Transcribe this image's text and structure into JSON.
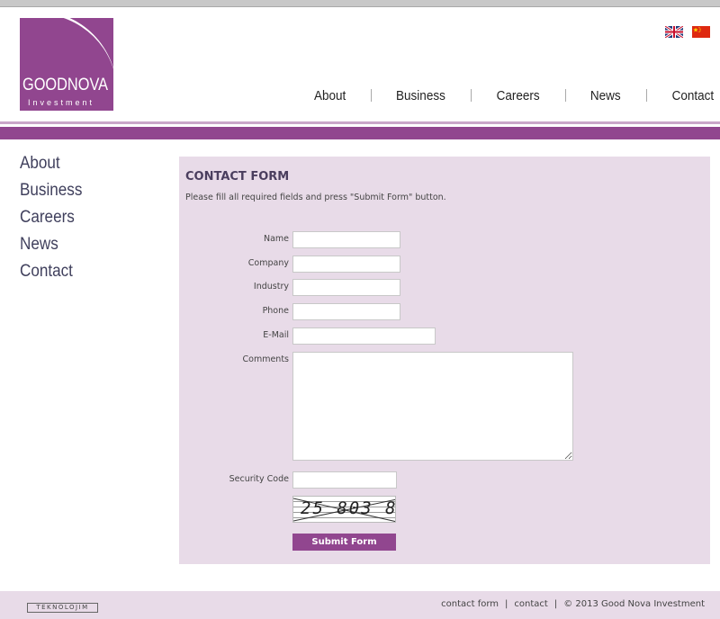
{
  "brand": {
    "name": "GOODNOVA",
    "sub": "Investment",
    "color": "#91468f"
  },
  "languages": [
    {
      "icon": "uk-flag-icon"
    },
    {
      "icon": "china-flag-icon"
    }
  ],
  "top_nav": [
    "About",
    "Business",
    "Careers",
    "News",
    "Contact"
  ],
  "side_nav": [
    "About",
    "Business",
    "Careers",
    "News",
    "Contact"
  ],
  "form": {
    "title": "CONTACT FORM",
    "instruction": "Please fill all required fields and press \"Submit Form\" button.",
    "fields": {
      "name": {
        "label": "Name",
        "value": ""
      },
      "company": {
        "label": "Company",
        "value": ""
      },
      "industry": {
        "label": "Industry",
        "value": ""
      },
      "phone": {
        "label": "Phone",
        "value": ""
      },
      "email": {
        "label": "E-Mail",
        "value": ""
      },
      "comments": {
        "label": "Comments",
        "value": ""
      },
      "security": {
        "label": "Security Code",
        "value": ""
      }
    },
    "captcha_text": "25 803 8",
    "submit_label": "Submit Form"
  },
  "footer": {
    "credit": "TEKNOLOJIM",
    "links": [
      "contact form",
      "contact"
    ],
    "copyright": "© 2013 Good Nova Investment"
  },
  "colors": {
    "accent": "#91468f",
    "panel": "#e8dbe8"
  }
}
